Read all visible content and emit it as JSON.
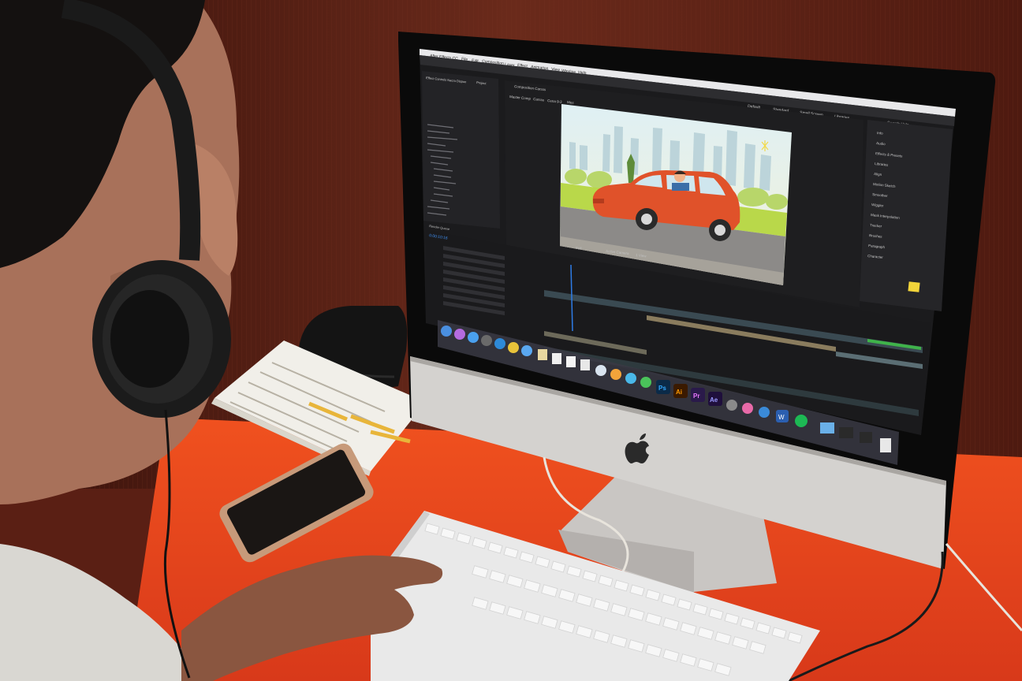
{
  "app": {
    "name": "After Effects CC",
    "menus": [
      "After Effects CC",
      "File",
      "Edit",
      "Composition",
      "Layer",
      "Effect",
      "Animation",
      "View",
      "Window",
      "Help"
    ],
    "workspaces": [
      "Default",
      "Standard",
      "Small Screen",
      "Libraries"
    ],
    "search_placeholder": "Search Help"
  },
  "project_panel": {
    "tab": "Project",
    "effect_tab": "Effect Controls Nacra Dispon"
  },
  "composition": {
    "tab": "Composition Carsss",
    "subtabs": [
      "Master Comp",
      "Carsss",
      "Cena 9-3",
      "Mes"
    ]
  },
  "viewer": {
    "zoom": "Full",
    "camera": "Active Camera",
    "views": "1 View"
  },
  "right_panel": {
    "items": [
      "Info",
      "Audio",
      "Effects & Presets",
      "Libraries",
      "Align",
      "Motion Sketch",
      "Smoother",
      "Wiggler",
      "Mask Interpolation",
      "Tracker",
      "Brushes",
      "Paragraph",
      "Character"
    ]
  },
  "timeline": {
    "timecode": "0:00:10:16",
    "render_queue": "Render Queue"
  },
  "dock": {
    "labels": [
      "Ps",
      "Ai",
      "Pr",
      "Ae",
      "W"
    ]
  },
  "colors": {
    "desk": "#e8441c",
    "wall": "#5a1f14",
    "car": "#e0522a",
    "sky": "#d6ecf0",
    "ae_purple": "#2a1a4a",
    "ps_blue": "#0b2a48",
    "ai_orange": "#3a1a00"
  }
}
